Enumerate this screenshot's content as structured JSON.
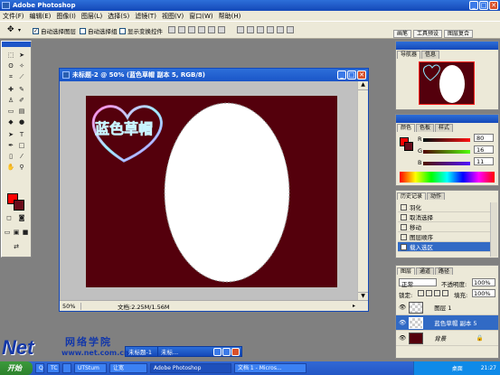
{
  "app": {
    "title": "Adobe Photoshop"
  },
  "menu": [
    "文件(F)",
    "编辑(E)",
    "图像(I)",
    "图层(L)",
    "选择(S)",
    "滤镜(T)",
    "视图(V)",
    "窗口(W)",
    "帮助(H)"
  ],
  "options": {
    "auto_select_layer": "自动选择图层",
    "auto_select_group": "自动选择组",
    "show_transform": "显示变换控件",
    "auto_select_layer_checked": "✓"
  },
  "palette_well": [
    "画笔",
    "工具预设",
    "图层复合"
  ],
  "document": {
    "title": "未标题-2 @ 50% (蓝色草帽 副本 5, RGB/8)",
    "zoom": "50%",
    "doc_size": "文档:2.25M/1.56M",
    "heart_text": "蓝色草帽"
  },
  "navigator": {
    "tabs": [
      "导航器",
      "信息"
    ]
  },
  "color_panel": {
    "tabs": [
      "颜色",
      "色板",
      "样式"
    ],
    "r_label": "R",
    "g_label": "G",
    "b_label": "B",
    "r": "80",
    "g": "16",
    "b": "11",
    "fg": "#ff0000",
    "bg": "#6a0b1a"
  },
  "history": {
    "tabs": [
      "历史记录",
      "动作"
    ],
    "items": [
      "羽化",
      "取消选择",
      "移动",
      "图层顺序",
      "载入选区"
    ],
    "selected_index": 4
  },
  "layers": {
    "tabs": [
      "图层",
      "通道",
      "路径"
    ],
    "blend_mode": "正常",
    "opacity_label": "不透明度:",
    "opacity": "100%",
    "lock_label": "锁定:",
    "fill_label": "填充:",
    "fill": "100%",
    "items": [
      "图层 1",
      "蓝色草帽 副本 5",
      "背景"
    ],
    "selected_index": 1
  },
  "minimized": [
    {
      "label": "未标题-1"
    },
    {
      "label": "未标..."
    }
  ],
  "watermark": {
    "brand": "Net",
    "sub": "网络学院",
    "url": "www.net.com.cn"
  },
  "taskbar": {
    "start": "开始",
    "tasks": [
      "Q",
      "TC",
      "",
      "UTStum",
      "让宽",
      "Adobe Photoshop",
      "文档 1 - Micros..."
    ],
    "tray_label": "桌面",
    "time": "21:27"
  },
  "colors": {
    "canvas": "#54000c",
    "titlebar": "#1d55c8",
    "selection": "#316ac5"
  }
}
